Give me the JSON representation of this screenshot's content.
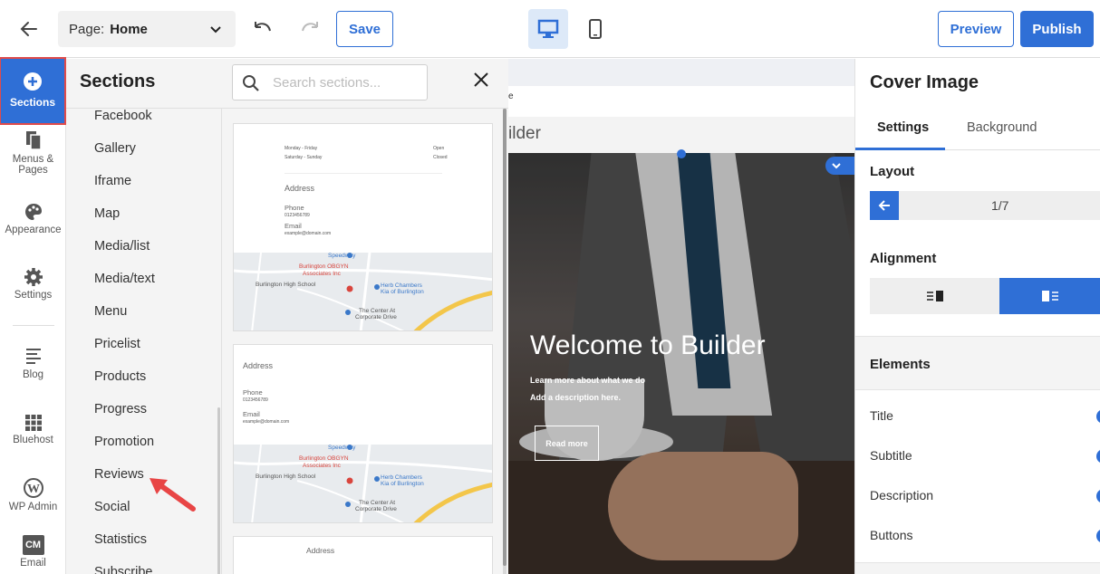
{
  "topbar": {
    "page_label": "Page:",
    "page_value": "Home",
    "save_label": "Save",
    "preview_label": "Preview",
    "publish_label": "Publish"
  },
  "rail": {
    "items": [
      {
        "label": "Sections",
        "icon": "plus-circle-icon"
      },
      {
        "label": "Menus &",
        "label2": "Pages",
        "icon": "pages-icon"
      },
      {
        "label": "Appearance",
        "icon": "palette-icon"
      },
      {
        "label": "Settings",
        "icon": "gear-icon"
      },
      {
        "label": "Blog",
        "icon": "blog-icon"
      },
      {
        "label": "Bluehost",
        "icon": "grid-icon"
      },
      {
        "label": "WP Admin",
        "icon": "wordpress-icon"
      },
      {
        "label": "Email",
        "icon": "cm-icon",
        "badge": "CM"
      }
    ]
  },
  "sections": {
    "title": "Sections",
    "search_placeholder": "Search sections...",
    "list": [
      "Facebook",
      "Gallery",
      "Iframe",
      "Map",
      "Media/list",
      "Media/text",
      "Menu",
      "Pricelist",
      "Products",
      "Progress",
      "Promotion",
      "Reviews",
      "Social",
      "Statistics",
      "Subscribe"
    ],
    "thumb1": {
      "hours_left1": "Monday - Friday",
      "hours_right1": "Open",
      "hours_left2": "Saturday - Sunday",
      "hours_right2": "Closed",
      "address": "Address",
      "phone": "Phone",
      "phone_val": "0123456789",
      "email": "Email",
      "email_val": "example@domain.com"
    },
    "thumb2": {
      "address": "Address",
      "phone": "Phone",
      "phone_val": "0123456789",
      "email": "Email",
      "email_val": "example@domain.com"
    },
    "thumb3": {
      "address": "Address"
    },
    "map": {
      "speedway": "Speedway",
      "obgyn": "Burlington OBGYN",
      "obgyn2": "Associates Inc",
      "school": "Burlington High School",
      "herb": "Herb Chambers",
      "herb2": "Kia of Burlington",
      "center": "The Center At",
      "center2": "Corporate Drive"
    }
  },
  "canvas": {
    "strip_text": "e",
    "header_text": "ilder",
    "hero_title": "Welcome to Builder",
    "hero_sub": "Learn more about what we do",
    "hero_desc": "Add a description here.",
    "read_more": "Read more"
  },
  "right_panel": {
    "title": "Cover Image",
    "tab_settings": "Settings",
    "tab_background": "Background",
    "layout_label": "Layout",
    "layout_value": "1/7",
    "alignment_label": "Alignment",
    "elements_label": "Elements",
    "elements": [
      "Title",
      "Subtitle",
      "Description",
      "Buttons"
    ]
  },
  "colors": {
    "accent": "#2f6fd6",
    "highlight": "#e04b4b"
  }
}
